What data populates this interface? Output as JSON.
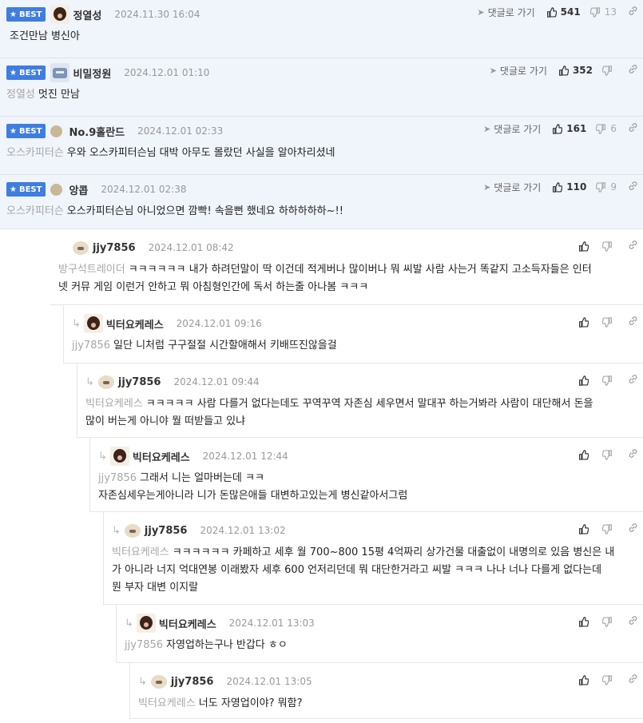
{
  "labels": {
    "best": "BEST",
    "goto_reply": "댓글로 가기"
  },
  "colors": {
    "best_bg": "#3f7de0",
    "best_row_bg": "#f0f4fb",
    "mention": "#a7a7a7"
  },
  "best_comments": [
    {
      "avatar_icon": "bear-avatar",
      "nick": "정열성",
      "date": "2024.11.30 16:04",
      "up": "541",
      "down": "13",
      "mention": "",
      "text": "조건만남 병신아"
    },
    {
      "avatar_icon": "robot-avatar",
      "nick": "비밀정원",
      "date": "2024.12.01 01:10",
      "up": "352",
      "down": "",
      "mention": "정열성",
      "text": "멋진 만남"
    },
    {
      "avatar_icon": "level-dot",
      "nick": "No.9홀란드",
      "date": "2024.12.01 02:33",
      "up": "161",
      "down": "6",
      "mention": "오스카피터슨",
      "text": "우와 오스카피터슨님 대박 아무도 몰랐던 사실을 알아차리셨네"
    },
    {
      "avatar_icon": "level-dot",
      "nick": "앙콥",
      "date": "2024.12.01 02:38",
      "up": "110",
      "down": "9",
      "mention": "오스카피터슨",
      "text": "오스카피터슨님 아니었으면 깜빡! 속을뻔 했네요 하하하하하~!!"
    }
  ],
  "replies": [
    {
      "avatar_icon": "puppy-avatar",
      "nick": "jjy7856",
      "date": "2024.12.01 08:42",
      "mention": "방구석트레이더",
      "lines": [
        "ㅋㅋㅋㅋㅋㅋ 내가 하려던말이 딱 이건데 적게버나 많이버나 뭐 씨발 사람 사는거 똑같지 고소득자들은 인터",
        "넷 커뮤 게임 이런거 안하고 뭐 아침형인간에 독서 하는줄 아나봄 ㅋㅋㅋ"
      ]
    },
    {
      "avatar_icon": "bear-avatar",
      "nick": "빅터요케레스",
      "date": "2024.12.01 09:16",
      "mention": "jjy7856",
      "lines": [
        "일단 니처럼 구구절절 시간할애해서 키배뜨진않을걸"
      ]
    },
    {
      "avatar_icon": "puppy-avatar",
      "nick": "jjy7856",
      "date": "2024.12.01 09:44",
      "mention": "빅터요케레스",
      "lines": [
        "ㅋㅋㅋㅋㅋ 사람 다를거 없다는데도 꾸역꾸역 자존심 세우면서 말대꾸 하는거봐라 사람이 대단해서 돈을",
        "많이 버는게 아니야 뭘 떠받들고 있냐"
      ]
    },
    {
      "avatar_icon": "bear-avatar",
      "nick": "빅터요케레스",
      "date": "2024.12.01 12:44",
      "mention": "jjy7856",
      "lines": [
        "그래서 니는 얼마버는데 ㅋㅋ",
        "자존심세우는게아니라 니가 돈많은애들 대변하고있는게 병신같아서그럼"
      ]
    },
    {
      "avatar_icon": "puppy-avatar",
      "nick": "jjy7856",
      "date": "2024.12.01 13:02",
      "mention": "빅터요케레스",
      "lines": [
        "ㅋㅋㅋㅋㅋㅋ 카페하고 세후 월 700~800 15평 4억짜리 상가건물 대출없이 내명의로 있음 병신은 내",
        "가 아니라 너지 억대연봉 이래봤자 세후 600 언저리던데 뭐 대단한거라고 씨발 ㅋㅋㅋ 나나 너나 다를게 없다는데",
        "뭔 부자 대변 이지랄"
      ]
    },
    {
      "avatar_icon": "bear-avatar",
      "nick": "빅터요케레스",
      "date": "2024.12.01 13:03",
      "mention": "jjy7856",
      "lines": [
        "자영업하는구나 반갑다 ㅎㅇ"
      ]
    },
    {
      "avatar_icon": "puppy-avatar",
      "nick": "jjy7856",
      "date": "2024.12.01 13:05",
      "mention": "빅터요케레스",
      "lines": [
        "너도 자영업이야? 뭐함?"
      ]
    }
  ]
}
